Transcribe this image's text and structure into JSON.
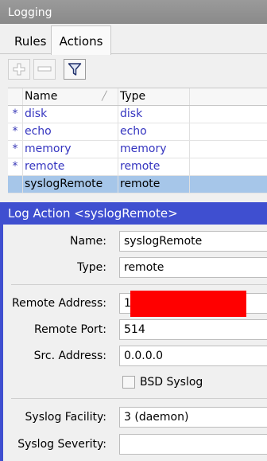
{
  "window": {
    "title": "Logging"
  },
  "tabs": [
    {
      "label": "Rules"
    },
    {
      "label": "Actions"
    }
  ],
  "toolbar": {
    "add_icon": "plus-icon",
    "remove_icon": "minus-icon",
    "filter_icon": "filter-icon"
  },
  "table": {
    "columns": [
      "Name",
      "Type"
    ],
    "rows": [
      {
        "mark": "*",
        "name": "disk",
        "type": "disk"
      },
      {
        "mark": "*",
        "name": "echo",
        "type": "echo"
      },
      {
        "mark": "*",
        "name": "memory",
        "type": "memory"
      },
      {
        "mark": "*",
        "name": "remote",
        "type": "remote"
      },
      {
        "mark": "",
        "name": "syslogRemote",
        "type": "remote"
      }
    ]
  },
  "panel": {
    "title": "Log Action <syslogRemote>",
    "name_label": "Name:",
    "name_value": "syslogRemote",
    "type_label": "Type:",
    "type_value": "remote",
    "remote_address_label": "Remote Address:",
    "remote_address_value": "1",
    "remote_port_label": "Remote Port:",
    "remote_port_value": "514",
    "src_address_label": "Src. Address:",
    "src_address_value": "0.0.0.0",
    "bsd_syslog_label": "BSD Syslog",
    "syslog_facility_label": "Syslog Facility:",
    "syslog_facility_value": "3 (daemon)",
    "syslog_severity_label": "Syslog Severity:",
    "syslog_severity_value": ""
  },
  "colors": {
    "accent": "#3f4fd0",
    "selected_row": "#a6c6e9",
    "link": "#3535c0",
    "redaction": "#ff0000"
  }
}
